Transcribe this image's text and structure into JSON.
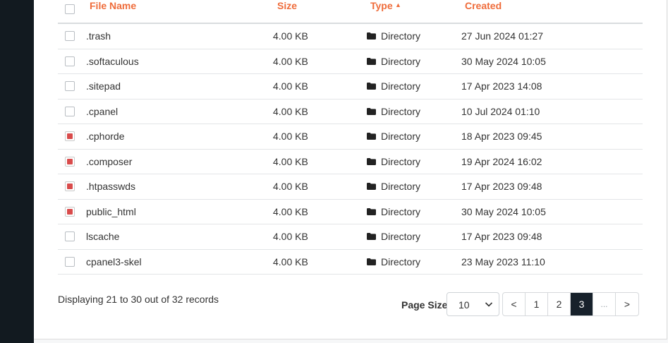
{
  "table": {
    "columns": {
      "name": "File Name",
      "size": "Size",
      "type": "Type",
      "created": "Created"
    },
    "sort": {
      "column": "type",
      "direction": "ascending",
      "icon": "caret-up-icon"
    },
    "rows": [
      {
        "name": ".trash",
        "size": "4.00 KB",
        "type": "Directory",
        "created": "27 Jun 2024 01:27",
        "checked": false
      },
      {
        "name": ".softaculous",
        "size": "4.00 KB",
        "type": "Directory",
        "created": "30 May 2024 10:05",
        "checked": false
      },
      {
        "name": ".sitepad",
        "size": "4.00 KB",
        "type": "Directory",
        "created": "17 Apr 2023 14:08",
        "checked": false
      },
      {
        "name": ".cpanel",
        "size": "4.00 KB",
        "type": "Directory",
        "created": "10 Jul 2024 01:10",
        "checked": false
      },
      {
        "name": ".cphorde",
        "size": "4.00 KB",
        "type": "Directory",
        "created": "18 Apr 2023 09:45",
        "checked": true
      },
      {
        "name": ".composer",
        "size": "4.00 KB",
        "type": "Directory",
        "created": "19 Apr 2024 16:02",
        "checked": true
      },
      {
        "name": ".htpasswds",
        "size": "4.00 KB",
        "type": "Directory",
        "created": "17 Apr 2023 09:48",
        "checked": true
      },
      {
        "name": "public_html",
        "size": "4.00 KB",
        "type": "Directory",
        "created": "30 May 2024 10:05",
        "checked": true
      },
      {
        "name": "lscache",
        "size": "4.00 KB",
        "type": "Directory",
        "created": "17 Apr 2023 09:48",
        "checked": false
      },
      {
        "name": "cpanel3-skel",
        "size": "4.00 KB",
        "type": "Directory",
        "created": "23 May 2023 11:10",
        "checked": false
      }
    ]
  },
  "footer": {
    "records_text": "Displaying 21 to 30 out of 32 records",
    "page_size_label": "Page Size",
    "page_size_value": "10",
    "pagination": [
      "<",
      "1",
      "2",
      "3",
      "...",
      ">"
    ],
    "current_page": "3"
  },
  "colors": {
    "accent": "#ef6c3b",
    "checked": "#d94b4b",
    "active_page": "#17212b",
    "sidebar": "#121a20"
  }
}
